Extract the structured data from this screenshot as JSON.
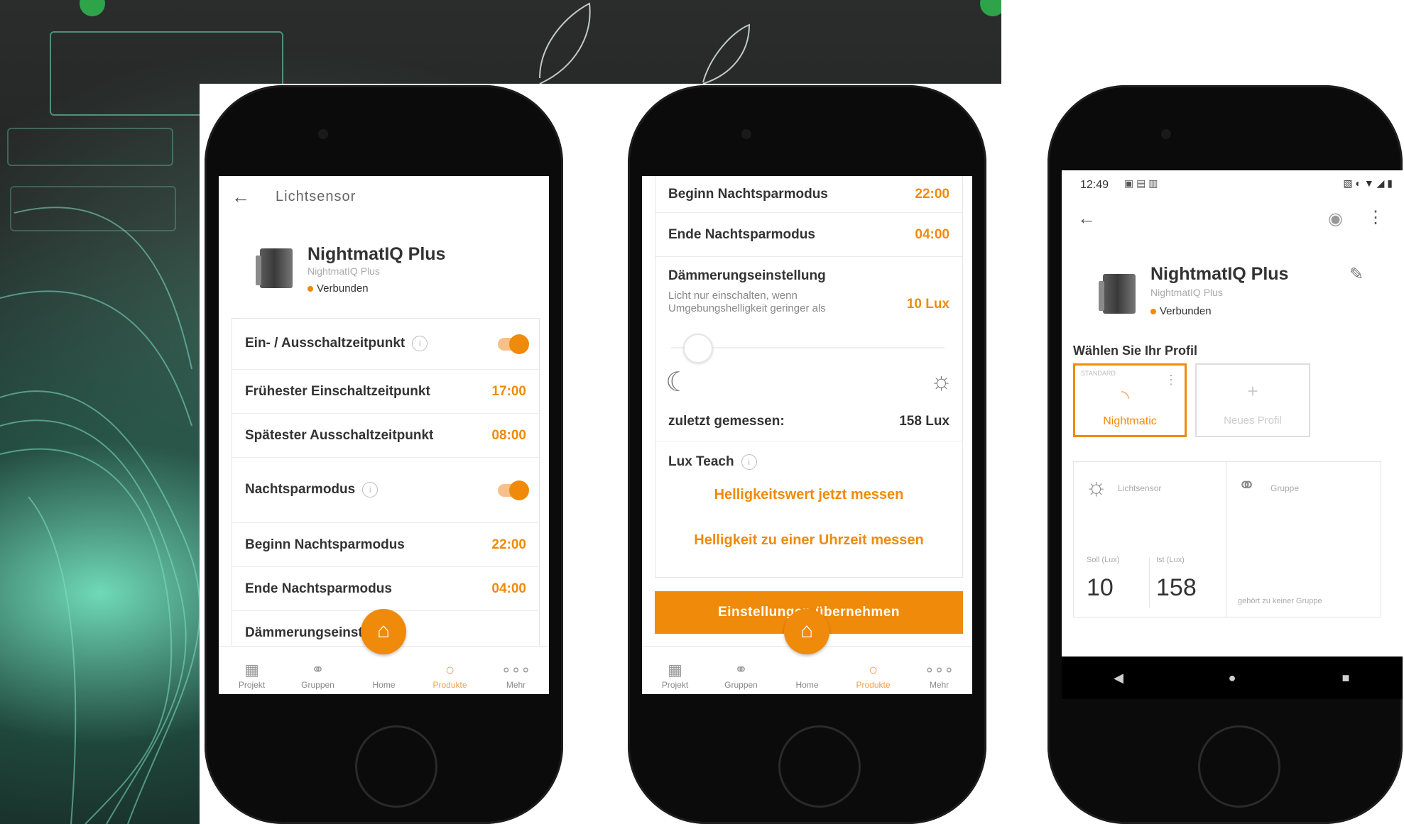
{
  "phone1": {
    "header_title": "Lichtsensor",
    "device_name": "NightmatIQ Plus",
    "device_model": "NightmatIQ Plus",
    "status": "Verbunden",
    "rows": [
      {
        "label": "Ein- / Ausschaltzeitpunkt",
        "type": "toggle"
      },
      {
        "label": "Frühester Einschaltzeitpunkt",
        "value": "17:00"
      },
      {
        "label": "Spätester Ausschaltzeitpunkt",
        "value": "08:00"
      },
      {
        "label": "Nachtsparmodus",
        "type": "toggle"
      },
      {
        "label": "Beginn Nachtsparmodus",
        "value": "22:00"
      },
      {
        "label": "Ende Nachtsparmodus",
        "value": "04:00"
      },
      {
        "label": "Dämmerungseinst"
      }
    ]
  },
  "phone2": {
    "rows": [
      {
        "label": "Beginn Nachtsparmodus",
        "value": "22:00"
      },
      {
        "label": "Ende Nachtsparmodus",
        "value": "04:00"
      }
    ],
    "dusk_title": "Dämmerungseinstellung",
    "dusk_desc_1": "Licht nur einschalten, wenn",
    "dusk_desc_2": "Umgebungshelligkeit geringer als",
    "dusk_value": "10 Lux",
    "slider_level": 0.05,
    "last_measured_label": "zuletzt gemessen:",
    "last_measured_value": "158 Lux",
    "lux_teach_label": "Lux Teach",
    "measure_now": "Helligkeitswert jetzt messen",
    "measure_at_time": "Helligkeit zu einer Uhrzeit messen",
    "apply_button": "Einstellungen übernehmen"
  },
  "tabs": [
    {
      "label": "Projekt",
      "icon": "building-icon"
    },
    {
      "label": "Gruppen",
      "icon": "groups-icon"
    },
    {
      "label": "Home",
      "icon": "home-icon"
    },
    {
      "label": "Produkte",
      "icon": "circle-icon"
    },
    {
      "label": "Mehr",
      "icon": "more-dots-icon"
    }
  ],
  "phone3": {
    "time": "12:49",
    "device_name": "NightmatIQ Plus",
    "device_model": "NightmatIQ Plus",
    "status": "Verbunden",
    "profile_heading": "Wählen Sie Ihr Profil",
    "profile_standard_tag": "STANDARD",
    "profile_active": "Nightmatic",
    "profile_new": "Neues Profil",
    "sensor_title": "Lichtsensor",
    "soll_label": "Soll (Lux)",
    "ist_label": "Ist (Lux)",
    "soll_value": "10",
    "ist_value": "158",
    "group_title": "Gruppe",
    "group_note": "gehört zu keiner Gruppe"
  },
  "colors": {
    "accent": "#f08a0a",
    "background_art": "#1a1c1c"
  }
}
